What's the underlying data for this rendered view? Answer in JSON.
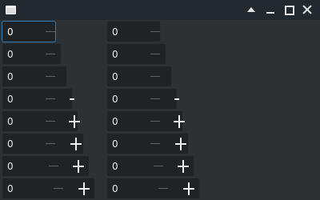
{
  "spinbuttons": {
    "left": [
      "0",
      "0",
      "0",
      "0",
      "0",
      "0",
      "0",
      "0"
    ],
    "right": [
      "0",
      "0",
      "0",
      "0",
      "0",
      "0",
      "0",
      "0"
    ]
  }
}
